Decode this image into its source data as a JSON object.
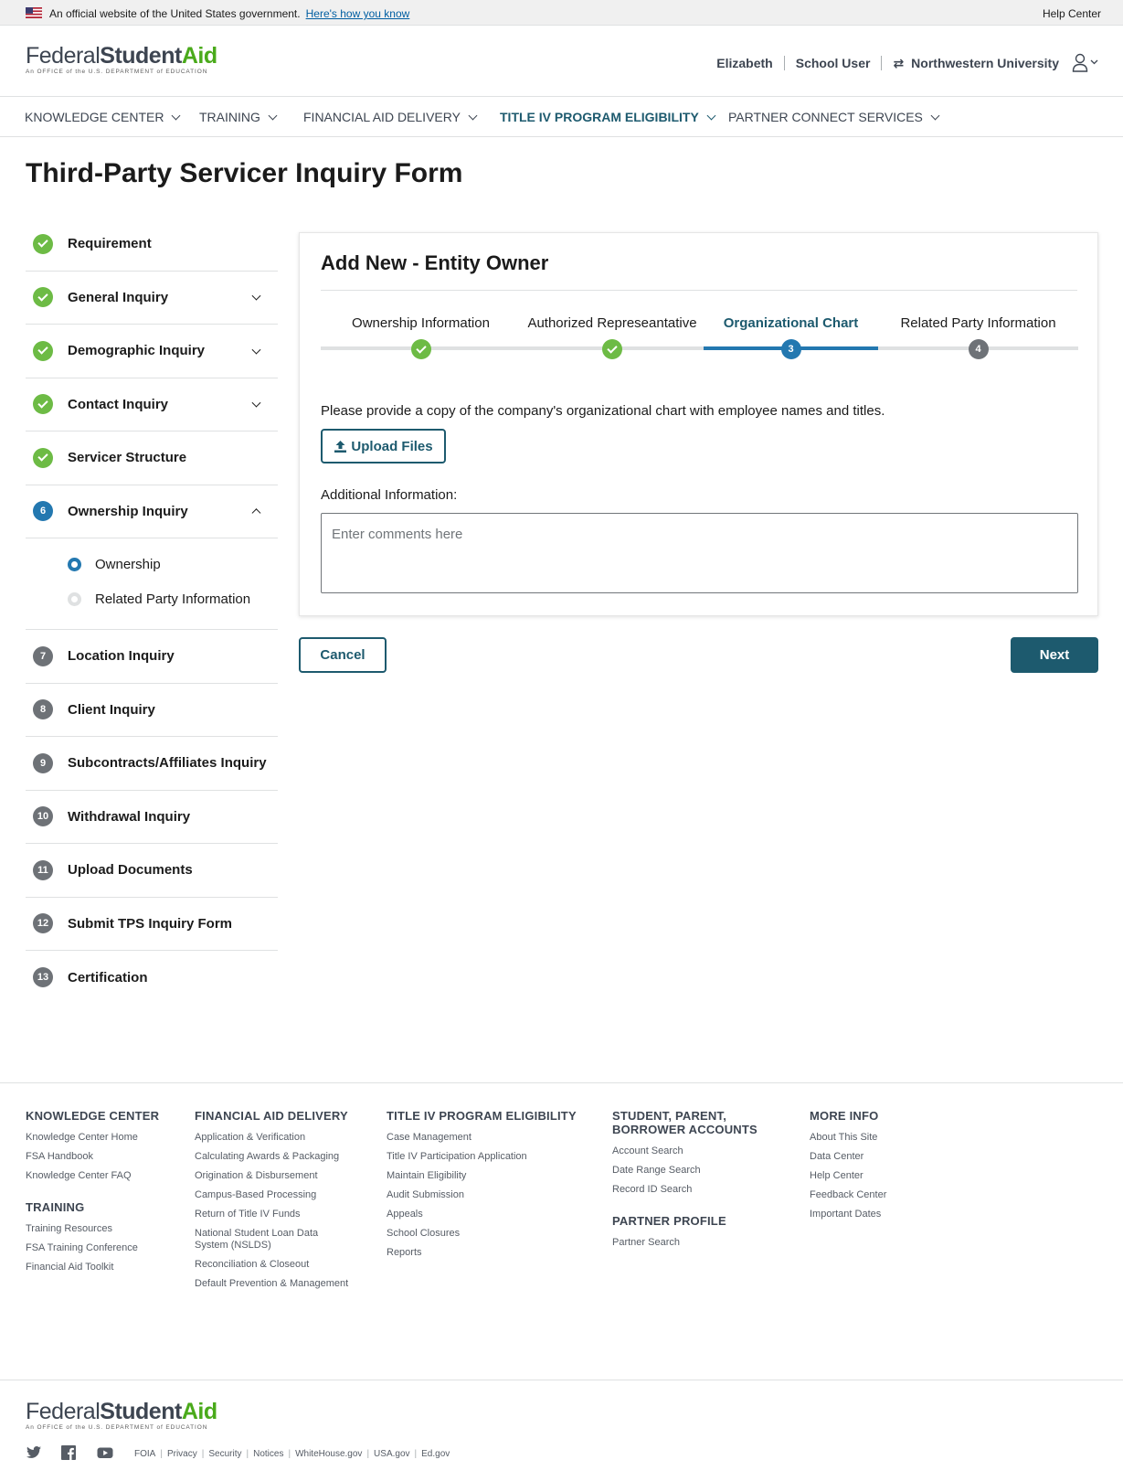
{
  "banner": {
    "text": "An official website of the United States government.",
    "link": "Here's how you know",
    "help": "Help Center"
  },
  "logo": {
    "federal": "Federal",
    "student": "Student",
    "aid": "Aid",
    "tagline": "An OFFICE of the U.S. DEPARTMENT of EDUCATION"
  },
  "user": {
    "name": "Elizabeth",
    "role": "School User",
    "school": "Northwestern University"
  },
  "nav": [
    "KNOWLEDGE CENTER",
    "TRAINING",
    "FINANCIAL AID DELIVERY",
    "TITLE IV PROGRAM ELIGIBILITY",
    "PARTNER CONNECT SERVICES"
  ],
  "nav_active": "TITLE IV PROGRAM ELIGIBILITY",
  "page_title": "Third-Party Servicer Inquiry Form",
  "sidebar": {
    "items": [
      {
        "label": "Requirement",
        "status": "done",
        "num": ""
      },
      {
        "label": "General Inquiry",
        "status": "done",
        "num": ""
      },
      {
        "label": "Demographic Inquiry",
        "status": "done",
        "num": ""
      },
      {
        "label": "Contact Inquiry",
        "status": "done",
        "num": ""
      },
      {
        "label": "Servicer Structure",
        "status": "done",
        "num": ""
      },
      {
        "label": "Ownership Inquiry",
        "status": "current",
        "num": "6"
      },
      {
        "label": "Location Inquiry",
        "status": "todo",
        "num": "7"
      },
      {
        "label": "Client Inquiry",
        "status": "todo",
        "num": "8"
      },
      {
        "label": "Subcontracts/Affiliates Inquiry",
        "status": "todo",
        "num": "9"
      },
      {
        "label": "Withdrawal Inquiry",
        "status": "todo",
        "num": "10"
      },
      {
        "label": "Upload Documents",
        "status": "todo",
        "num": "11"
      },
      {
        "label": "Submit TPS Inquiry Form",
        "status": "todo",
        "num": "12"
      },
      {
        "label": "Certification",
        "status": "todo",
        "num": "13"
      }
    ],
    "sub_items": [
      "Ownership",
      "Related Party Information"
    ]
  },
  "card": {
    "title": "Add New - Entity Owner",
    "steps": [
      {
        "label": "Ownership Information",
        "status": "done",
        "num": ""
      },
      {
        "label": "Authorized Represeantative",
        "status": "done",
        "num": ""
      },
      {
        "label": "Organizational Chart",
        "status": "current",
        "num": "3"
      },
      {
        "label": "Related Party Information",
        "status": "todo",
        "num": "4"
      }
    ],
    "instruction": "Please provide a copy of the company's organizational chart with employee names and titles.",
    "upload_label": "Upload Files",
    "additional_label": "Additional Information:",
    "comments_placeholder": "Enter comments here",
    "comments_value": ""
  },
  "buttons": {
    "cancel": "Cancel",
    "next": "Next"
  },
  "footer": {
    "knowledge": {
      "head": "KNOWLEDGE CENTER",
      "links": [
        "Knowledge Center Home",
        "FSA Handbook",
        "Knowledge Center FAQ"
      ]
    },
    "training": {
      "head": "TRAINING",
      "links": [
        "Training Resources",
        "FSA Training Conference",
        "Financial Aid Toolkit"
      ]
    },
    "fad": {
      "head": "FINANCIAL AID DELIVERY",
      "links": [
        "Application & Verification",
        "Calculating Awards & Packaging",
        "Origination & Disbursement",
        "Campus-Based Processing",
        "Return of Title IV Funds",
        "National Student Loan Data System (NSLDS)",
        "Reconciliation & Closeout",
        "Default Prevention & Management"
      ]
    },
    "t4": {
      "head": "TITLE IV PROGRAM ELIGIBILITY",
      "links": [
        "Case Management",
        "Title IV Participation Application",
        "Maintain Eligibility",
        "Audit Submission",
        "Appeals",
        "School Closures",
        "Reports"
      ]
    },
    "accounts": {
      "head": "STUDENT, PARENT, BORROWER ACCOUNTS",
      "links": [
        "Account Search",
        "Date Range Search",
        "Record ID Search"
      ]
    },
    "partner": {
      "head": "PARTNER PROFILE",
      "links": [
        "Partner Search"
      ]
    },
    "more": {
      "head": "MORE INFO",
      "links": [
        "About This Site",
        "Data Center",
        "Help Center",
        "Feedback Center",
        "Important Dates"
      ]
    },
    "legal": [
      "FOIA",
      "Privacy",
      "Security",
      "Notices",
      "WhiteHouse.gov",
      "USA.gov",
      "Ed.gov"
    ],
    "social": [
      "twitter-icon",
      "facebook-icon",
      "youtube-icon"
    ]
  },
  "colors": {
    "primary": "#1d5a6e",
    "done": "#6dbb45",
    "current": "#2378b0",
    "todo": "#6e7277",
    "aid_green": "#4aaa1b"
  }
}
